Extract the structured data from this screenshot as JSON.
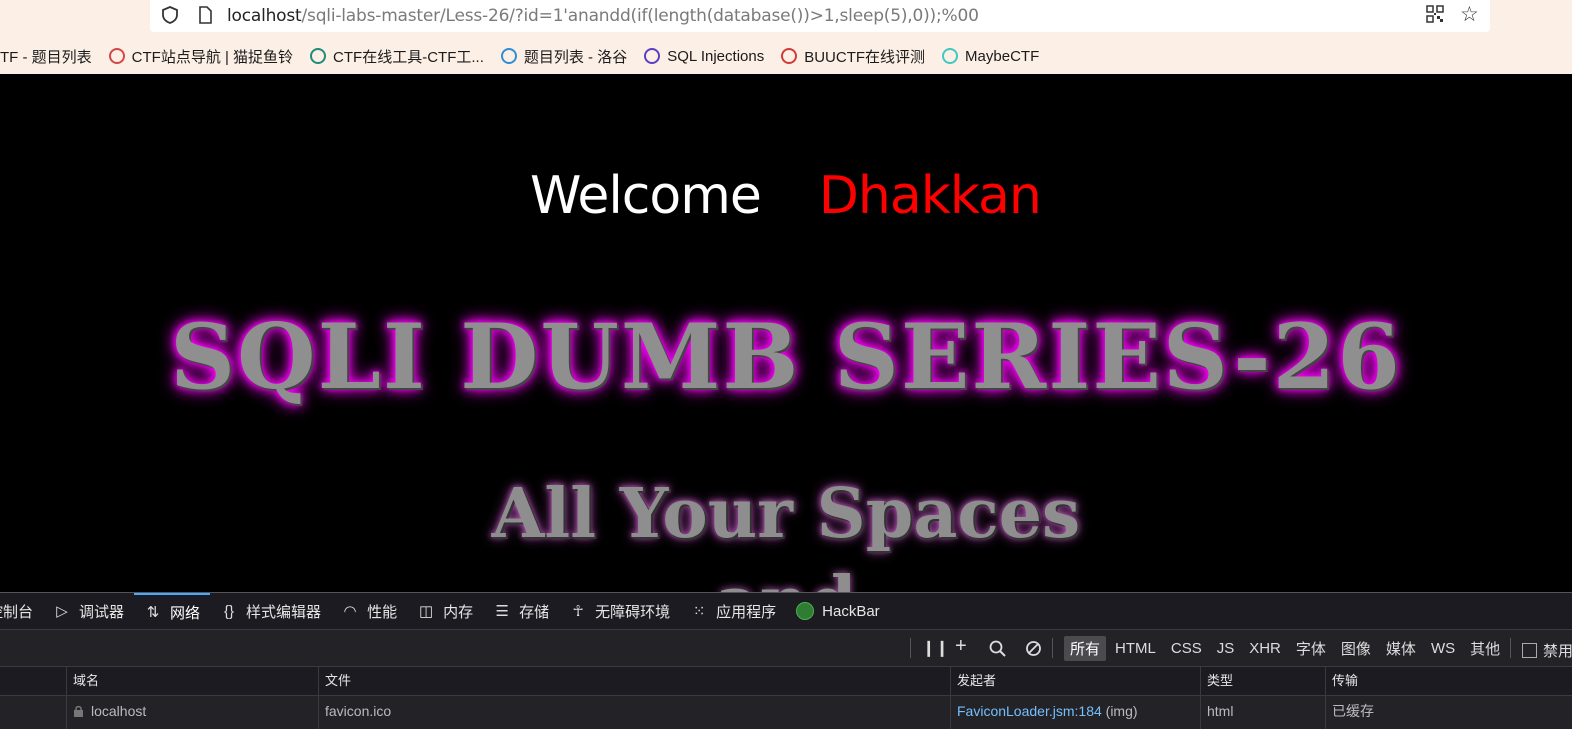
{
  "browser": {
    "url_host": "localhost",
    "url_path": "/sqli-labs-master/Less-26/?id=1'anandd(if(length(database())>1,sleep(5),0));%00",
    "bookmarks": [
      {
        "label": "TF - 题目列表",
        "icon": "ctf-icon",
        "color": "#888888"
      },
      {
        "label": "CTF站点导航 | 猫捉鱼铃",
        "icon": "cat-icon",
        "color": "#d44848"
      },
      {
        "label": "CTF在线工具-CTF工...",
        "icon": "tool-icon",
        "color": "#1e8c7a"
      },
      {
        "label": "题目列表 - 洛谷",
        "icon": "luogu-icon",
        "color": "#2f8ed6"
      },
      {
        "label": "SQL Injections",
        "icon": "globe-icon",
        "color": "#5b3fc4"
      },
      {
        "label": "BUUCTF在线评测",
        "icon": "buu-icon",
        "color": "#d43a3a"
      },
      {
        "label": "MaybeCTF",
        "icon": "maybectf-icon",
        "color": "#3fc9c0"
      }
    ]
  },
  "page": {
    "welcome": "Welcome",
    "name": "Dhakkan",
    "title": "SQLI DUMB SERIES-26",
    "subtitle": "All Your Spaces",
    "subtitle2": "and"
  },
  "devtools": {
    "tabs": [
      {
        "label": "控制台",
        "icon": "console-icon",
        "glyph": "",
        "active": false
      },
      {
        "label": "调试器",
        "icon": "debugger-icon",
        "glyph": "▷",
        "active": false
      },
      {
        "label": "网络",
        "icon": "network-icon",
        "glyph": "⇅",
        "active": true
      },
      {
        "label": "样式编辑器",
        "icon": "style-editor-icon",
        "glyph": "{}",
        "active": false
      },
      {
        "label": "性能",
        "icon": "performance-icon",
        "glyph": "◠",
        "active": false
      },
      {
        "label": "内存",
        "icon": "memory-icon",
        "glyph": "◫",
        "active": false
      },
      {
        "label": "存储",
        "icon": "storage-icon",
        "glyph": "☰",
        "active": false
      },
      {
        "label": "无障碍环境",
        "icon": "accessibility-icon",
        "glyph": "☥",
        "active": false
      },
      {
        "label": "应用程序",
        "icon": "application-icon",
        "glyph": "⁙",
        "active": false
      },
      {
        "label": "HackBar",
        "icon": "hackbar-icon",
        "glyph": "",
        "active": false
      }
    ],
    "filters": [
      "所有",
      "HTML",
      "CSS",
      "JS",
      "XHR",
      "字体",
      "图像",
      "媒体",
      "WS",
      "其他"
    ],
    "active_filter": "所有",
    "persist_label": "禁用",
    "columns": [
      "域名",
      "文件",
      "发起者",
      "类型",
      "传输"
    ],
    "rows": [
      {
        "domain": "localhost",
        "file": "favicon.ico",
        "initiator_link": "FaviconLoader.jsm",
        "initiator_line": ":184",
        "initiator_suffix": " (img)",
        "type": "html",
        "transfer": "已缓存"
      }
    ]
  }
}
